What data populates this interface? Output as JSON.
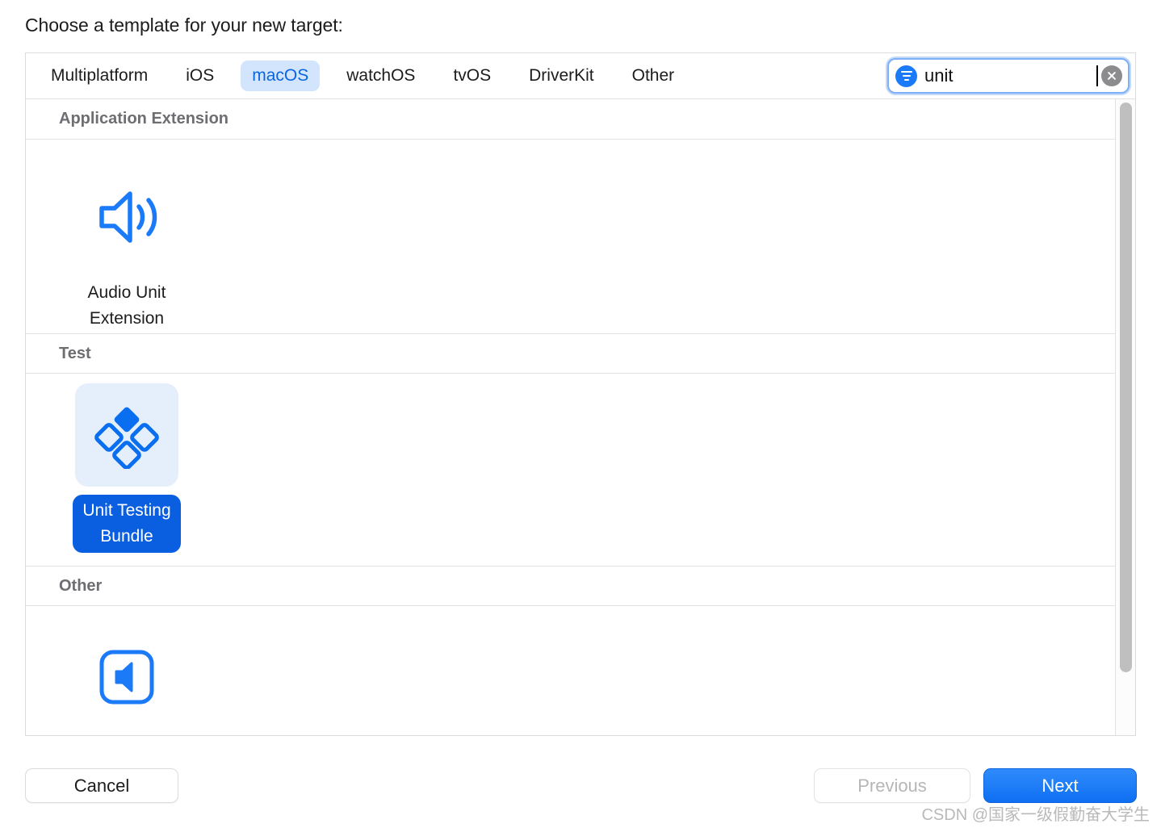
{
  "page_title": "Choose a template for your new target:",
  "tabs": [
    {
      "label": "Multiplatform",
      "selected": false
    },
    {
      "label": "iOS",
      "selected": false
    },
    {
      "label": "macOS",
      "selected": true
    },
    {
      "label": "watchOS",
      "selected": false
    },
    {
      "label": "tvOS",
      "selected": false
    },
    {
      "label": "DriverKit",
      "selected": false
    },
    {
      "label": "Other",
      "selected": false
    }
  ],
  "search": {
    "value": "unit",
    "placeholder": "",
    "filter_icon": "filter-icon",
    "clear_icon": "clear-icon"
  },
  "sections": [
    {
      "header": "Application Extension",
      "items": [
        {
          "label": "Audio Unit\nExtension",
          "icon": "speaker-waves-icon",
          "selected": false
        }
      ]
    },
    {
      "header": "Test",
      "items": [
        {
          "label": "Unit Testing\nBundle",
          "icon": "diamonds-test-icon",
          "selected": true
        }
      ]
    },
    {
      "header": "Other",
      "items": [
        {
          "label": "",
          "icon": "speaker-boxed-icon",
          "selected": false
        }
      ]
    }
  ],
  "footer": {
    "cancel": "Cancel",
    "previous": "Previous",
    "next": "Next"
  },
  "watermark": "CSDN @国家一级假勤奋大学生",
  "colors": {
    "accent": "#0a66e0",
    "selected_pill_bg": "#0a5fe0",
    "tab_selected_bg": "#d3e5fd",
    "icon_blue": "#1a7af8",
    "panel_border": "#dcdcdc",
    "section_text": "#6d6d72"
  }
}
